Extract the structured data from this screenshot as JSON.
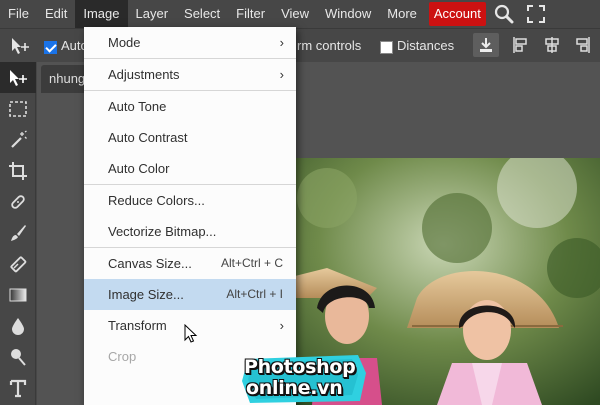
{
  "menubar": {
    "items": [
      "File",
      "Edit",
      "Image",
      "Layer",
      "Select",
      "Filter",
      "View",
      "Window",
      "More"
    ],
    "account_label": "Account",
    "icons": [
      "search-icon",
      "fullscreen-icon"
    ],
    "colors": {
      "account": "#cc1111"
    }
  },
  "options_bar": {
    "auto_select_label": "Auto",
    "auto_select_checked": true,
    "transform_controls_label": "rm controls",
    "distances_label": "Distances",
    "distances_checked": false
  },
  "document": {
    "tab_label": "nhung"
  },
  "image_menu": {
    "sections": [
      [
        {
          "label": "Mode",
          "submenu": true
        }
      ],
      [
        {
          "label": "Adjustments",
          "submenu": true
        }
      ],
      [
        {
          "label": "Auto Tone"
        },
        {
          "label": "Auto Contrast"
        },
        {
          "label": "Auto Color"
        }
      ],
      [
        {
          "label": "Reduce Colors..."
        },
        {
          "label": "Vectorize Bitmap..."
        }
      ],
      [
        {
          "label": "Canvas Size...",
          "shortcut": "Alt+Ctrl + C"
        },
        {
          "label": "Image Size...",
          "shortcut": "Alt+Ctrl + I",
          "highlighted": true
        },
        {
          "label": "Transform",
          "submenu": true
        },
        {
          "label": "Crop",
          "disabled": true
        }
      ]
    ],
    "colors": {
      "highlight": "#c3daf0"
    }
  },
  "watermark": {
    "line1": "Photoshop",
    "line2": "online.vn"
  }
}
